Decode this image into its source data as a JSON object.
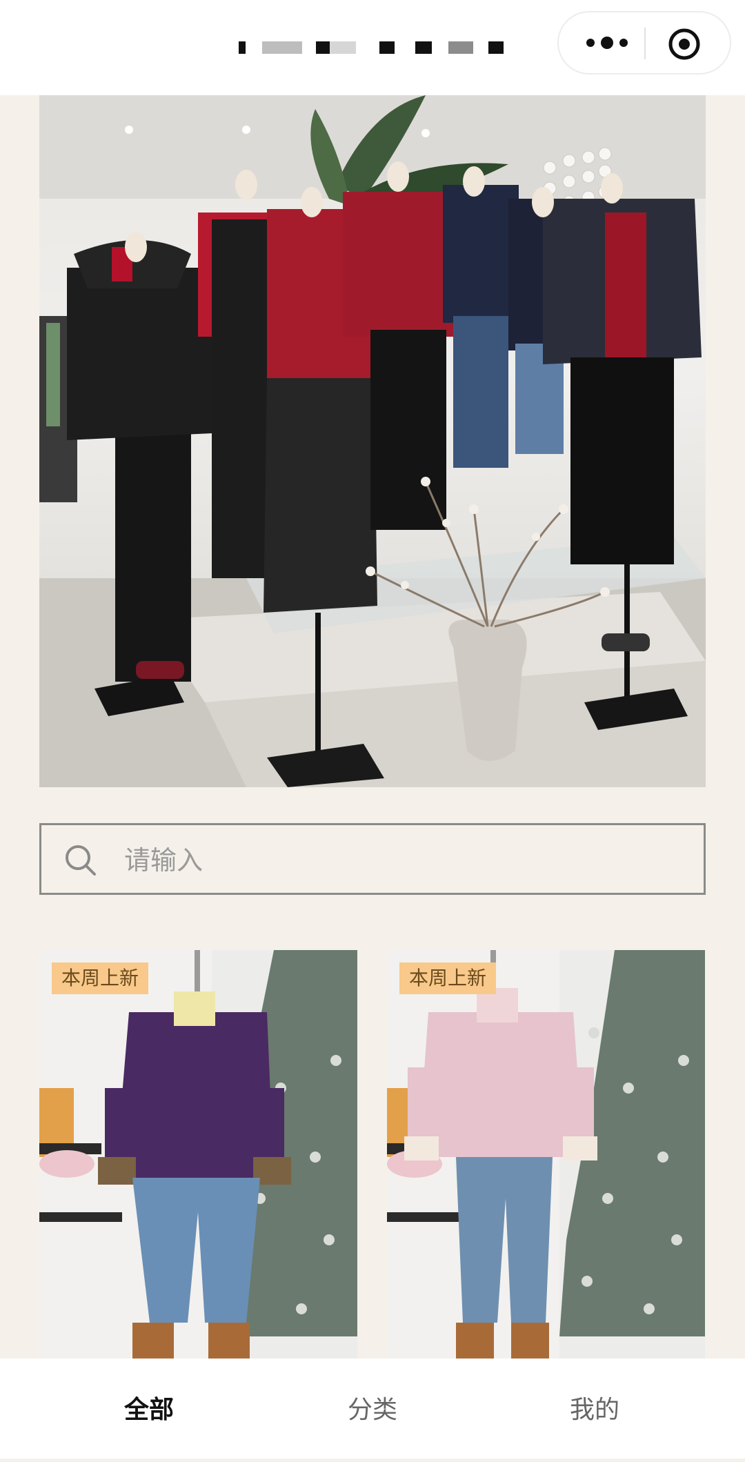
{
  "navbar": {
    "menu_icon": "more-dots-icon",
    "close_icon": "target-circle-icon"
  },
  "banner": {
    "alt": "boutique mannequin display"
  },
  "search": {
    "placeholder": "请输入",
    "icon": "search-icon"
  },
  "products": [
    {
      "badge": "本周上新",
      "colors": {
        "jacket": "#4a2a63",
        "pants": "#6a8fb6"
      }
    },
    {
      "badge": "本周上新",
      "colors": {
        "jacket": "#e6c3cd",
        "pants": "#6e8fb0"
      }
    }
  ],
  "tabbar": {
    "tabs": [
      {
        "label": "全部",
        "active": true
      },
      {
        "label": "分类",
        "active": false
      },
      {
        "label": "我的",
        "active": false
      }
    ]
  },
  "colors": {
    "background": "#f5f1ea",
    "badge_bg": "#f8c98a",
    "badge_text": "#6b4a1d"
  }
}
